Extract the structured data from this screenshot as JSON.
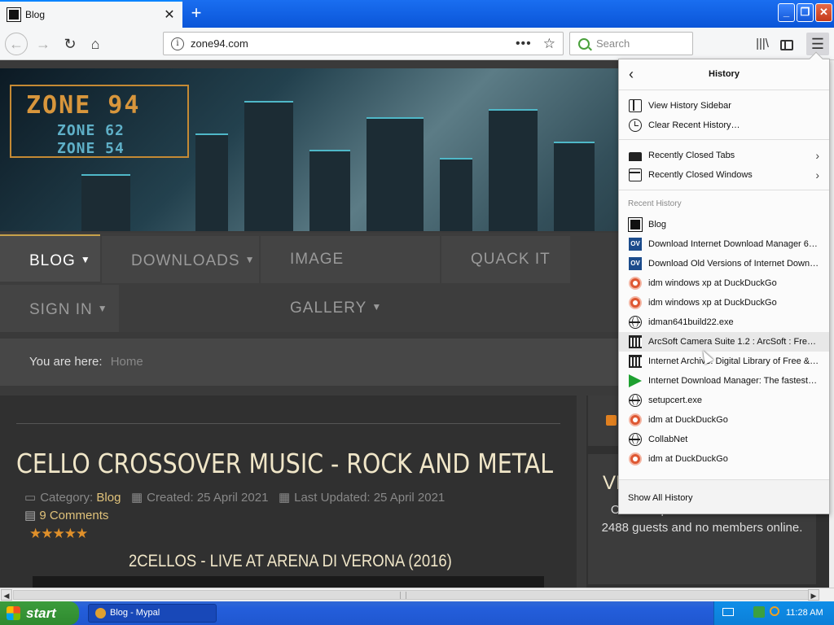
{
  "browser": {
    "tab_title": "Blog",
    "new_tab": "+",
    "tab_close": "✕",
    "url": "zone94.com",
    "url_info": "i",
    "page_actions": "•••",
    "bookmark_star": "☆",
    "search_placeholder": "Search",
    "back": "←",
    "forward": "→",
    "reload": "↻",
    "home": "⌂",
    "library": "|||\\",
    "menu": "☰",
    "win_min": "_",
    "win_max": "❐",
    "win_close": "✕"
  },
  "site": {
    "logo_main": "ZONE 94",
    "logo_sub1": "ZONE 62",
    "logo_sub2": "ZONE 54",
    "nav": {
      "blog": "BLOG",
      "downloads": "DOWNLOADS",
      "gallery": "IMAGE GALLERY",
      "quack": "QUACK IT",
      "signin": "SIGN IN",
      "caret": "▼"
    },
    "breadcrumb": {
      "label": "You are here:",
      "home": "Home"
    },
    "post": {
      "title": "CELLO CROSSOVER MUSIC - ROCK AND METAL",
      "category_label": "Category:",
      "category": "Blog",
      "created": "Created: 25 April 2021",
      "updated": "Last Updated: 25 April 2021",
      "comments": "9 Comments",
      "rating": 5,
      "stars": "★★★★★",
      "subtitle": "2CELLOS - LIVE AT ARENA DI VERONA (2016)"
    },
    "visitors": {
      "heading": "VI",
      "text": "Over the past 15 minutes we had: 2488 guests and no members online."
    }
  },
  "history_panel": {
    "title": "History",
    "back": "‹",
    "chevron": "›",
    "view_sidebar": "View History Sidebar",
    "clear_recent": "Clear Recent History…",
    "recently_closed_tabs": "Recently Closed Tabs",
    "recently_closed_windows": "Recently Closed Windows",
    "recent_heading": "Recent History",
    "items": [
      {
        "label": "Blog",
        "icon": "blog-icon"
      },
      {
        "label": "Download Internet Download Manager 6.…",
        "icon": "ov-icon"
      },
      {
        "label": "Download Old Versions of Internet Downl…",
        "icon": "ov-icon"
      },
      {
        "label": "idm windows xp at DuckDuckGo",
        "icon": "duckduckgo-icon"
      },
      {
        "label": "idm windows xp at DuckDuckGo",
        "icon": "duckduckgo-icon"
      },
      {
        "label": "idman641build22.exe",
        "icon": "globe-icon"
      },
      {
        "label": "ArcSoft Camera Suite 1.2 : ArcSoft : Free…",
        "icon": "archive-icon"
      },
      {
        "label": "Internet Archive: Digital Library of Free & …",
        "icon": "archive-icon"
      },
      {
        "label": "Internet Download Manager: The fastest …",
        "icon": "idm-icon"
      },
      {
        "label": "setupcert.exe",
        "icon": "globe-icon"
      },
      {
        "label": "idm at DuckDuckGo",
        "icon": "duckduckgo-icon"
      },
      {
        "label": "CollabNet",
        "icon": "globe-icon"
      },
      {
        "label": "idm at DuckDuckGo",
        "icon": "duckduckgo-icon"
      }
    ],
    "show_all": "Show All History"
  },
  "taskbar": {
    "start": "start",
    "task": "Blog - Mypal",
    "clock": "11:28 AM"
  },
  "colors": {
    "accent": "#0a84ff",
    "site_gold": "#e0c27a",
    "taskbar_blue": "#245edb",
    "start_green": "#3c9c3c"
  }
}
